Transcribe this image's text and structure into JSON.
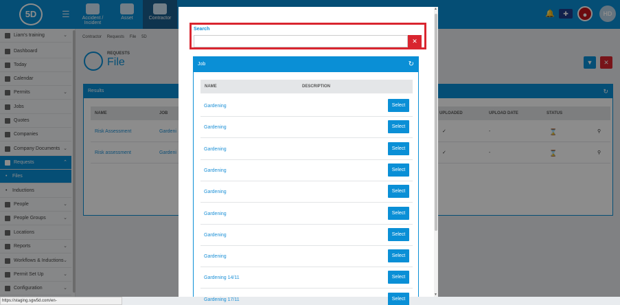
{
  "header": {
    "logo": "5D",
    "nav": [
      {
        "label": "Accident / Incident"
      },
      {
        "label": "Asset"
      },
      {
        "label": "Contractor"
      }
    ],
    "avatar": "HD"
  },
  "sidebar": {
    "items": [
      {
        "label": "Liam's training"
      },
      {
        "label": "Dashboard"
      },
      {
        "label": "Today"
      },
      {
        "label": "Calendar"
      },
      {
        "label": "Permits"
      },
      {
        "label": "Jobs"
      },
      {
        "label": "Quotes"
      },
      {
        "label": "Companies"
      },
      {
        "label": "Company Documents"
      },
      {
        "label": "Requests"
      },
      {
        "label": "Files"
      },
      {
        "label": "Inductions"
      },
      {
        "label": "People"
      },
      {
        "label": "People Groups"
      },
      {
        "label": "Locations"
      },
      {
        "label": "Reports"
      },
      {
        "label": "Workflows & Inductions"
      },
      {
        "label": "Permit Set Up"
      },
      {
        "label": "Configuration"
      }
    ]
  },
  "breadcrumb": [
    "Contractor",
    "Requests",
    "File",
    "5D"
  ],
  "page": {
    "subtitle": "REQUESTS",
    "title": "File"
  },
  "results": {
    "title": "Results",
    "columns": {
      "name": "NAME",
      "job": "JOB",
      "uploaded": "UPLOADED",
      "upload_date": "UPLOAD DATE",
      "status": "STATUS"
    },
    "rows": [
      {
        "name": "Risk Assessment",
        "job": "Gardeni",
        "upload_date": "-"
      },
      {
        "name": "Risk assessment",
        "job": "Gardeni",
        "upload_date": "-"
      }
    ]
  },
  "modal": {
    "search": {
      "label": "Search",
      "value": "",
      "placeholder": ""
    },
    "job_panel": {
      "title": "Job",
      "columns": {
        "name": "NAME",
        "description": "DESCRIPTION"
      },
      "select_label": "Select",
      "rows": [
        {
          "name": "Gardening"
        },
        {
          "name": "Gardening"
        },
        {
          "name": "Gardening"
        },
        {
          "name": "Gardening"
        },
        {
          "name": "Gardening"
        },
        {
          "name": "Gardening"
        },
        {
          "name": "Gardening"
        },
        {
          "name": "Gardening"
        },
        {
          "name": "Gardening 14/11"
        },
        {
          "name": "Gardening 17/11"
        }
      ]
    }
  },
  "status_url": "https://staging.sgw5d.com/en-GB/contractor/requests/files/view/274",
  "colors": {
    "primary": "#0a8fd6",
    "danger": "#d9252f",
    "nav_active": "#1b5f8e"
  }
}
